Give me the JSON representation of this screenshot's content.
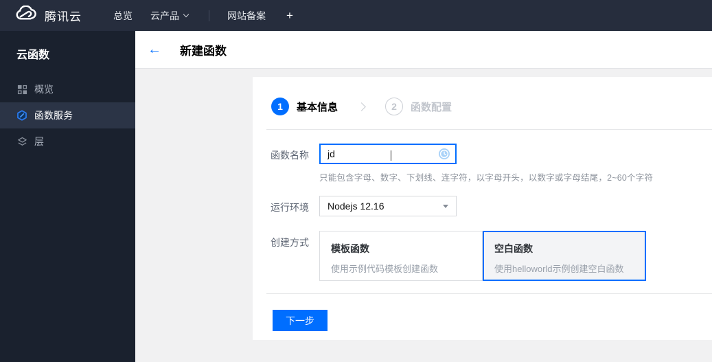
{
  "topbar": {
    "brand": "腾讯云",
    "nav": [
      {
        "label": "总览"
      },
      {
        "label": "云产品"
      },
      {
        "label": "网站备案"
      },
      {
        "label": "+"
      }
    ]
  },
  "sidebar": {
    "title": "云函数",
    "items": [
      {
        "label": "概览",
        "icon": "grid-icon",
        "active": false
      },
      {
        "label": "函数服务",
        "icon": "scf-hexagon-icon",
        "active": true
      },
      {
        "label": "层",
        "icon": "layers-icon",
        "active": false
      }
    ]
  },
  "header": {
    "back": "←",
    "title": "新建函数"
  },
  "wizard": {
    "steps": [
      {
        "number": "1",
        "label": "基本信息",
        "active": true
      },
      {
        "number": "2",
        "label": "函数配置",
        "active": false
      }
    ]
  },
  "form": {
    "name": {
      "label": "函数名称",
      "value": "jd",
      "icon": "clock-pending-icon",
      "help": "只能包含字母、数字、下划线、连字符，以字母开头，以数字或字母结尾，2~60个字符"
    },
    "runtime": {
      "label": "运行环境",
      "value": "Nodejs 12.16"
    },
    "method": {
      "label": "创建方式",
      "options": [
        {
          "title": "模板函数",
          "desc": "使用示例代码模板创建函数",
          "selected": false
        },
        {
          "title": "空白函数",
          "desc": "使用helloworld示例创建空白函数",
          "selected": true
        }
      ]
    }
  },
  "footer": {
    "next_label": "下一步"
  },
  "colors": {
    "accent": "#006eff",
    "topbar_bg": "#262d3d",
    "sidebar_bg": "#1a212e",
    "sidebar_active_bg": "#2b3446",
    "content_bg": "#f1f1f2",
    "selected_card_bg": "#f3f4f6"
  }
}
